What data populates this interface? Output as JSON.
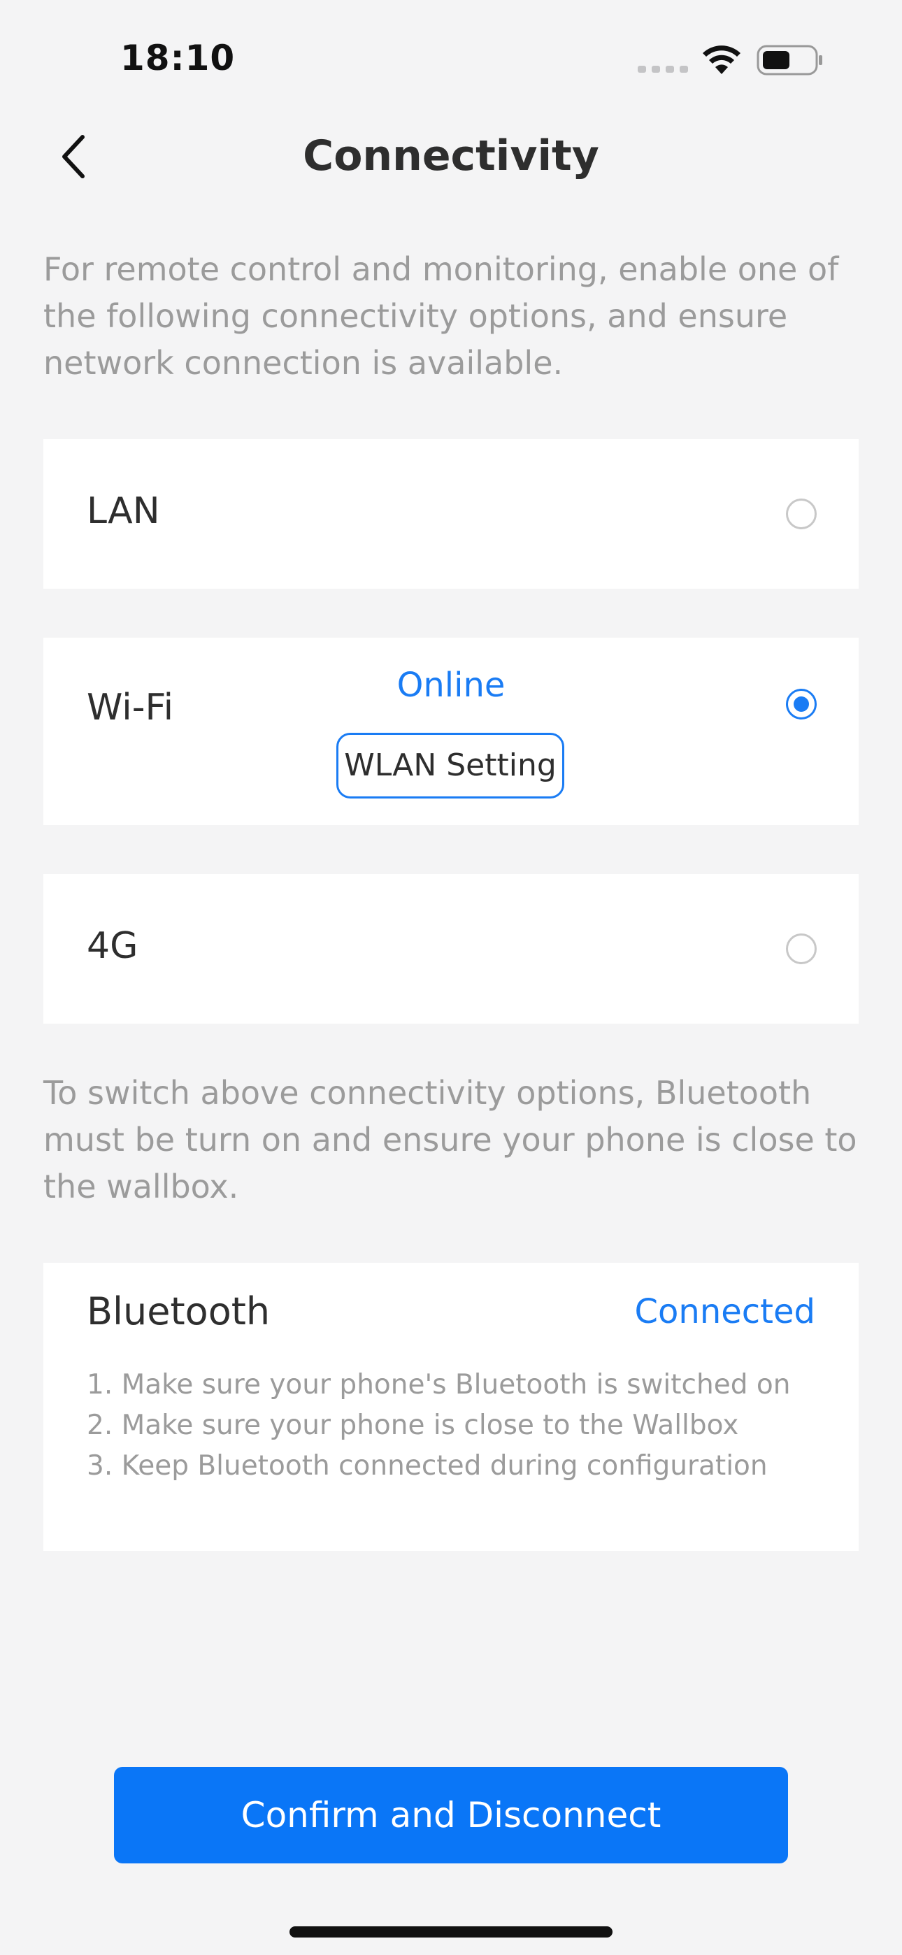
{
  "status_bar": {
    "time": "18:10",
    "icons": [
      "signal-dots-icon",
      "wifi-icon",
      "battery-icon"
    ]
  },
  "header": {
    "title": "Connectivity",
    "back_icon": "chevron-left-icon"
  },
  "intro": "For remote control and monitoring, enable one of the following connectivity options, and ensure network connection is available.",
  "options": [
    {
      "label": "LAN",
      "selected": false
    },
    {
      "label": "Wi-Fi",
      "status": "Online",
      "button_label": "WLAN Setting",
      "selected": true
    },
    {
      "label": "4G",
      "selected": false
    }
  ],
  "switch_note": "To switch above connectivity options, Bluetooth must be turn on and ensure your phone is close to the wallbox.",
  "bluetooth": {
    "title": "Bluetooth",
    "status": "Connected",
    "steps": [
      "1. Make sure your phone's Bluetooth is switched on",
      "2. Make sure your phone is close to the Wallbox",
      "3. Keep Bluetooth connected during configuration"
    ]
  },
  "confirm_button": "Confirm and Disconnect",
  "colors": {
    "accent": "#1a7cf4",
    "background": "#f4f4f5",
    "muted_text": "#9b9b9b"
  }
}
